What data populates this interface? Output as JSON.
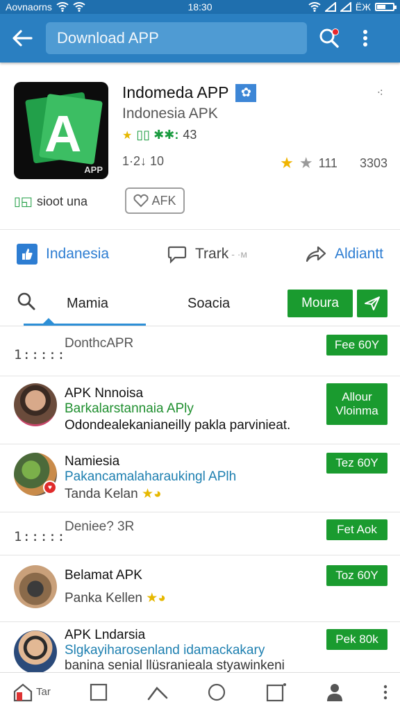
{
  "status_bar": {
    "left_text": "Aovnaorns",
    "time": "18:30",
    "right_text": "ЁЖ",
    "battery_level": 0.5
  },
  "app_bar": {
    "title": "Download APP"
  },
  "app": {
    "name": "Indomeda APP",
    "verified_icon": "badge-icon",
    "subtitle": "Indonesia APK",
    "rating_text": "43",
    "icon_letter": "A",
    "icon_brand": "APP",
    "meta_left": "1·2↓ 10",
    "meta_right_a": "111",
    "meta_right_b": "3303",
    "installs_label": "sioot una",
    "apk_chip_label": "AFK"
  },
  "actions": [
    {
      "label": "Indanesia",
      "color": "#2d7dd2"
    },
    {
      "label": "Trark",
      "suffix": "- ·м",
      "color": "#444444"
    },
    {
      "label": "Aldiantt",
      "color": "#2d7dd2"
    }
  ],
  "tabs": {
    "tab1": "Mamia",
    "tab2": "Soacia",
    "button": "Moura"
  },
  "list": [
    {
      "title": "DonthcAPR",
      "grid": "1:::::",
      "button": "Fee 60Y"
    },
    {
      "title": "APK Nnnoisa",
      "line2": "Barkalarstannaia APly",
      "line3": "Odondealekanianeilly pakla parvinieat.",
      "button_l1": "Allour",
      "button_l2": "Vloinma"
    },
    {
      "title": "Namiesia",
      "line2": "Pakancamalaharaukingl APlh",
      "line3": "Tanda Kelan",
      "button": "Tez 60Y"
    },
    {
      "title": "Deniee? 3R",
      "grid": "1:::::",
      "button": "Fet Aok"
    },
    {
      "title": "Belamat APK",
      "line2": "Panka Kellen",
      "button": "Toz 60Y"
    },
    {
      "title": "APK Lndarsia",
      "line2": "Slgkayiharosenland idamackakary",
      "line3": "banina senial llüsranieala styawinkeni",
      "button": "Pek 80k"
    }
  ],
  "nav": {
    "home_label": "Tar"
  },
  "colors": {
    "primary": "#2a7fc1",
    "green": "#1a9b2f",
    "accent": "#2d8fd6"
  }
}
